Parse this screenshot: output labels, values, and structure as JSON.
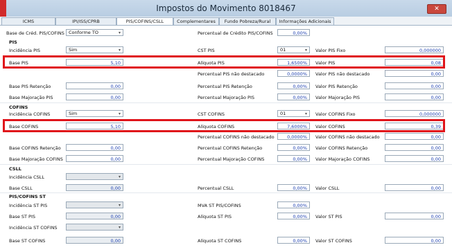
{
  "window": {
    "title": "Impostos do Movimento 8018467",
    "close_label": "✕"
  },
  "tabs": [
    "ICMS",
    "IPI/ISS/CPRB",
    "PIS/COFINS/CSLL",
    "Complementares",
    "Fundo Pobreza/Rural",
    "Informações Adicionais"
  ],
  "top": {
    "base_calc_label": "Base de Créd. PIS/COFINS",
    "base_calc_value": "Conforme TO",
    "perc_credito_label": "Percentual de Crédito PIS/COFINS",
    "perc_credito_value": "0,00%"
  },
  "pis": {
    "title": "PIS",
    "incidencia_label": "Incidência PIS",
    "incidencia_value": "Sim",
    "cst_label": "CST PIS",
    "cst_value": "01",
    "valor_fixo_label": "Valor PIS Fixo",
    "valor_fixo_value": "0,000000",
    "base_label": "Base PIS",
    "base_value": "5,10",
    "aliquota_label": "Alíquota PIS",
    "aliquota_value": "1,6500%",
    "valor_label": "Valor PIS",
    "valor_value": "0,08",
    "perc_nd_label": "Percentual PIS não destacado",
    "perc_nd_value": "0,0000%",
    "valor_nd_label": "Valor PIS não destacado",
    "valor_nd_value": "0,00",
    "base_ret_label": "Base PIS Retenção",
    "base_ret_value": "0,00",
    "perc_ret_label": "Percentual PIS Retenção",
    "perc_ret_value": "0,00%",
    "valor_ret_label": "Valor PIS Retenção",
    "valor_ret_value": "0,00",
    "base_maj_label": "Base Majoração PIS",
    "base_maj_value": "0,00",
    "perc_maj_label": "Percentual Majoração PIS",
    "perc_maj_value": "0,00%",
    "valor_maj_label": "Valor Majoração PIS",
    "valor_maj_value": "0,00"
  },
  "cofins": {
    "title": "COFINS",
    "incidencia_label": "Incidência COFINS",
    "incidencia_value": "Sim",
    "cst_label": "CST COFINS",
    "cst_value": "01",
    "valor_fixo_label": "Valor COFINS Fixo",
    "valor_fixo_value": "0,000000",
    "base_label": "Base COFINS",
    "base_value": "5,10",
    "aliquota_label": "Alíquota COFINS",
    "aliquota_value": "7,6000%",
    "valor_label": "Valor COFINS",
    "valor_value": "0,39",
    "perc_nd_label": "Percentual COFINS não destacado",
    "perc_nd_value": "0,0000%",
    "valor_nd_label": "Valor COFINS não destacado",
    "valor_nd_value": "0,00",
    "base_ret_label": "Base COFINS Retenção",
    "base_ret_value": "0,00",
    "perc_ret_label": "Percentual COFINS Retenção",
    "perc_ret_value": "0,00%",
    "valor_ret_label": "Valor COFINS Retenção",
    "valor_ret_value": "0,00",
    "base_maj_label": "Base Majoração COFINS",
    "base_maj_value": "0,00",
    "perc_maj_label": "Percentual Majoração COFINS",
    "perc_maj_value": "0,00%",
    "valor_maj_label": "Valor Majoração COFINS",
    "valor_maj_value": "0,00"
  },
  "csll": {
    "title": "CSLL",
    "incidencia_label": "Incidência CSLL",
    "incidencia_value": "",
    "base_label": "Base CSLL",
    "base_value": "0,00",
    "perc_label": "Percentual CSLL",
    "perc_value": "0,00%",
    "valor_label": "Valor CSLL",
    "valor_value": "0,00"
  },
  "st": {
    "title": "PIS/COFINS ST",
    "inc_pis_label": "Incidência ST PIS",
    "inc_pis_value": "",
    "mva_label": "MVA ST PIS/COFINS",
    "mva_value": "0,00%",
    "base_pis_label": "Base ST PIS",
    "base_pis_value": "0,00",
    "aliq_pis_label": "Alíquota ST PIS",
    "aliq_pis_value": "0,00%",
    "valor_pis_label": "Valor ST PIS",
    "valor_pis_value": "0,00",
    "inc_cofins_label": "Incidência ST COFINS",
    "inc_cofins_value": "",
    "base_cofins_label": "Base ST COFINS",
    "base_cofins_value": "0,00",
    "aliq_cofins_label": "Alíquota ST COFINS",
    "aliq_cofins_value": "0,00%",
    "valor_cofins_label": "Valor ST COFINS",
    "valor_cofins_value": "0,00"
  },
  "icons": {
    "dropdown": "chevron-down-icon",
    "close": "close-icon"
  },
  "colors": {
    "highlight": "#e0141a",
    "value_text": "#1b3fb0",
    "title_strip": "#d12b2b"
  }
}
